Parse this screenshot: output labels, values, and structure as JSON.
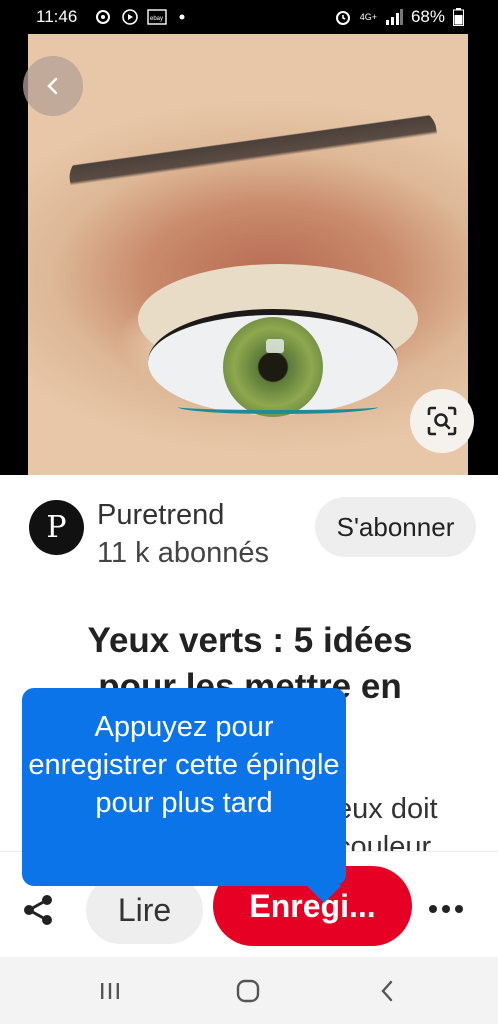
{
  "status_bar": {
    "time": "11:46",
    "battery": "68%",
    "network": "4G+"
  },
  "creator": {
    "avatar_letter": "P",
    "name": "Puretrend",
    "followers": "11 k abonnés",
    "follow_label": "S'abonner"
  },
  "pin": {
    "title_line1": "Yeux verts : 5 idées",
    "title_line2": "pour les mettre en",
    "desc_line1": "eux doit",
    "desc_line2": "couleur"
  },
  "tooltip": {
    "text": "Appuyez pour enregistrer cette épingle pour plus tard"
  },
  "actions": {
    "read_label": "Lire",
    "save_label": "Enregi..."
  },
  "colors": {
    "save_red": "#e60023",
    "tooltip_blue": "#0a74e8"
  }
}
